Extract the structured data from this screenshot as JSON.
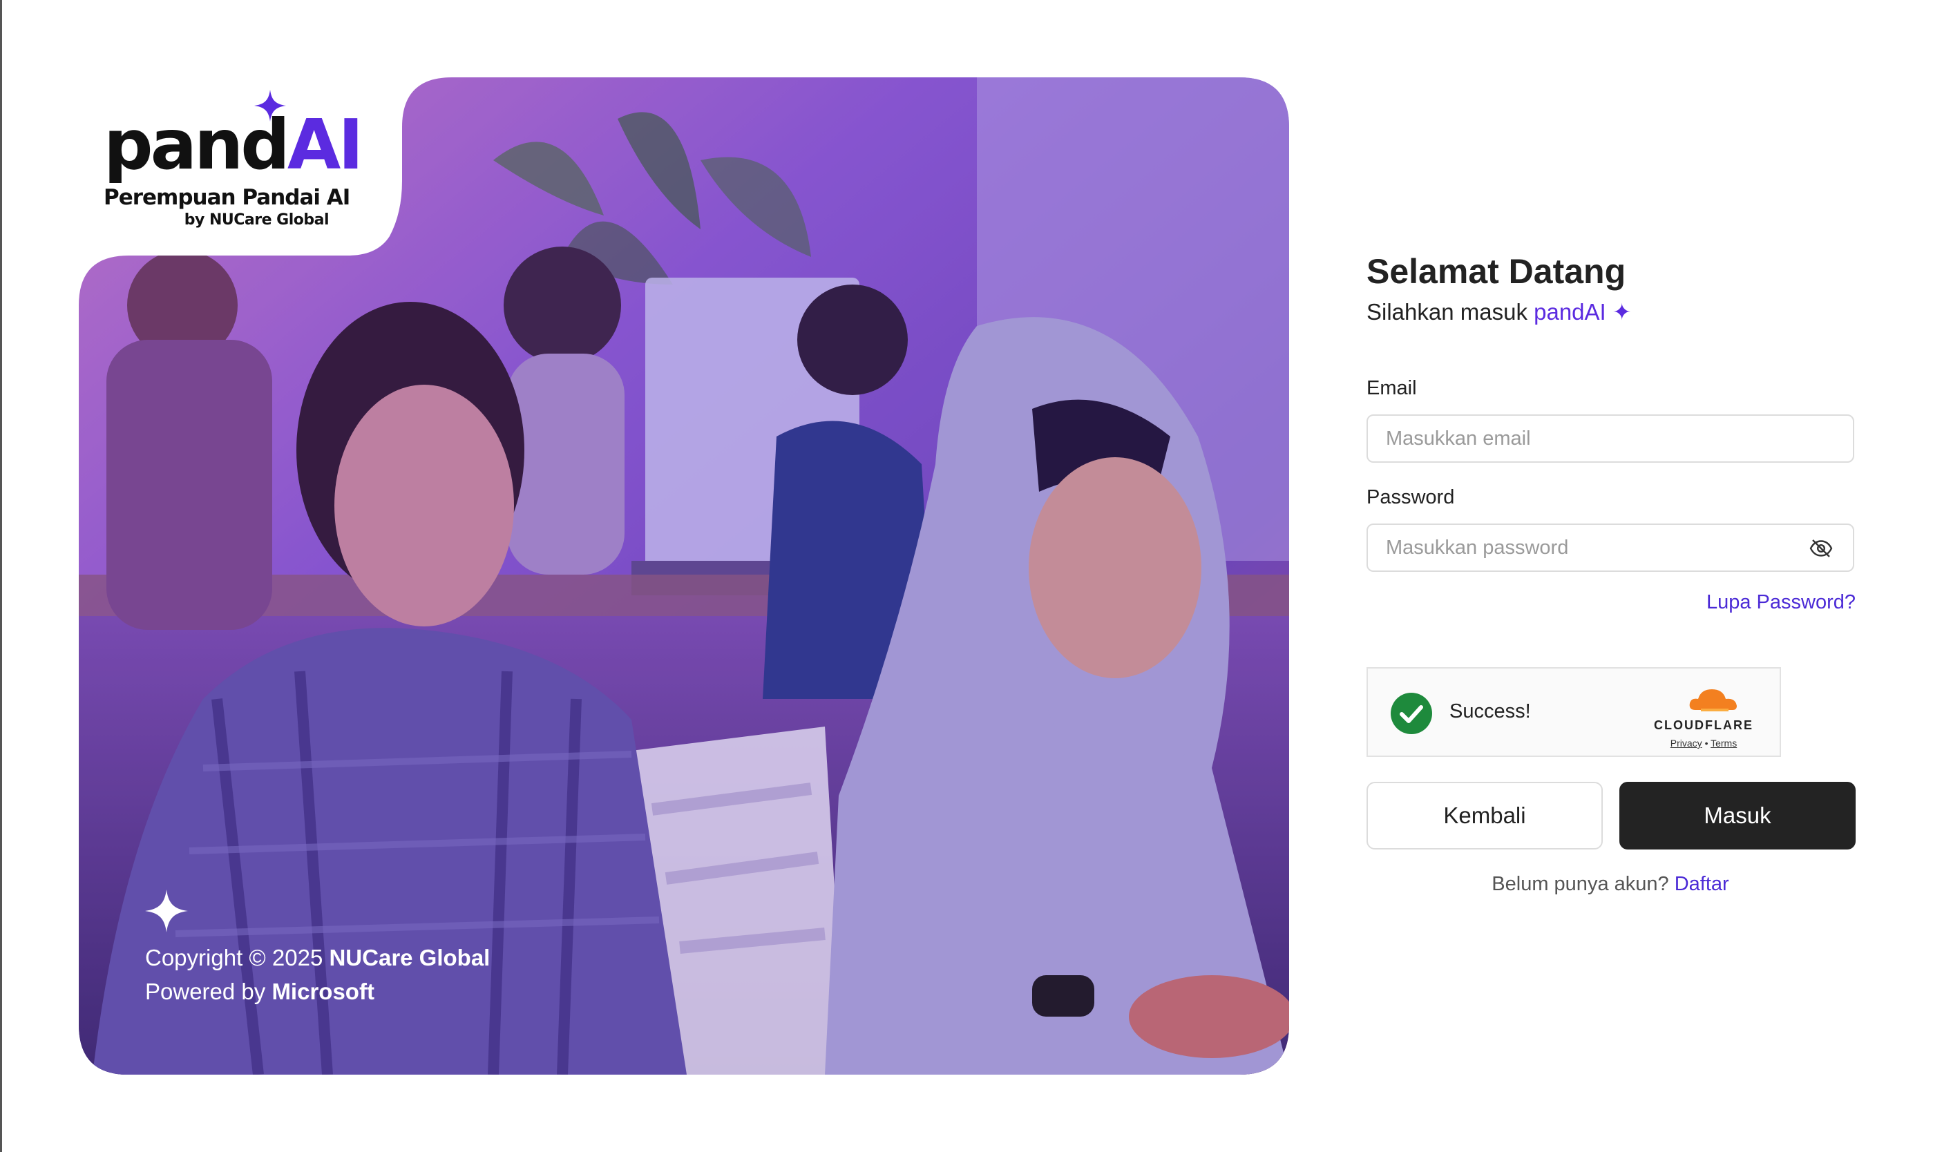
{
  "colors": {
    "accent": "#5b2be0",
    "link": "#4b2ad6",
    "primary_button": "#232323",
    "success_green": "#1e8a3c",
    "cloudflare_orange": "#f38020"
  },
  "hero": {
    "logo": {
      "wordmark_dark": "pand",
      "wordmark_accent": "AI",
      "tagline": "Perempuan Pandai AI",
      "byline": "by NUCare Global"
    },
    "copyright_prefix": "Copyright © 2025 ",
    "copyright_owner": "NUCare Global",
    "powered_prefix": "Powered by ",
    "powered_by": "Microsoft",
    "image_description": "two women at computers in a classroom, purple tinted photo"
  },
  "login": {
    "title": "Selamat Datang",
    "subtitle_prefix": "Silahkan masuk ",
    "subtitle_brand": "pandAI ✦",
    "email_label": "Email",
    "email_placeholder": "Masukkan email",
    "password_label": "Password",
    "password_placeholder": "Masukkan password",
    "password_toggle_icon": "eye-off-icon",
    "forgot_link": "Lupa Password?",
    "captcha": {
      "status": "Success!",
      "provider": "CLOUDFLARE",
      "privacy": "Privacy",
      "separator": "•",
      "terms": "Terms"
    },
    "back_button": "Kembali",
    "login_button": "Masuk",
    "signup_prompt": "Belum punya akun? ",
    "signup_link": "Daftar"
  }
}
